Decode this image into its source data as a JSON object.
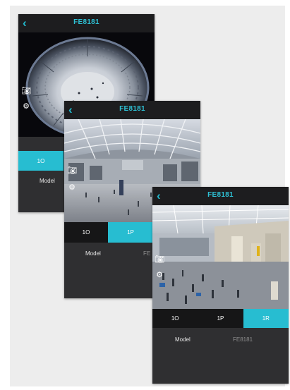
{
  "colors": {
    "accent": "#27bdd1",
    "header_bg": "#1d1d1f",
    "panel_bg": "#2f2f31",
    "tab_bg": "#161617"
  },
  "screens": [
    {
      "title": "FE8181",
      "tabs": [
        {
          "label": "1O",
          "active": true
        }
      ],
      "info": {
        "label": "Model",
        "value": ""
      },
      "icons": [
        "back-chevron-icon",
        "camera-icon",
        "settings-gear-icon"
      ]
    },
    {
      "title": "FE8181",
      "tabs": [
        {
          "label": "1O",
          "active": false
        },
        {
          "label": "1P",
          "active": true
        }
      ],
      "info": {
        "label": "Model",
        "value": "FE"
      },
      "icons": [
        "back-chevron-icon",
        "camera-icon",
        "settings-gear-icon"
      ]
    },
    {
      "title": "FE8181",
      "tabs": [
        {
          "label": "1O",
          "active": false
        },
        {
          "label": "1P",
          "active": false
        },
        {
          "label": "1R",
          "active": true
        }
      ],
      "info": {
        "label": "Model",
        "value": "FE8181"
      },
      "icons": [
        "back-chevron-icon",
        "camera-icon",
        "settings-gear-icon"
      ]
    }
  ]
}
